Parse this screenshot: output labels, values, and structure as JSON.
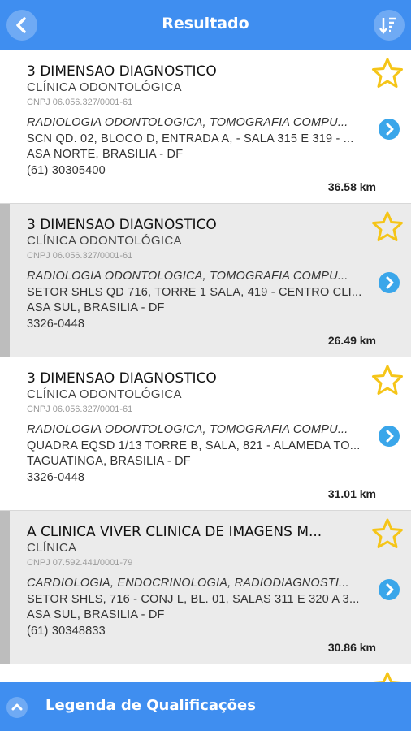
{
  "header": {
    "title": "Resultado",
    "back_icon": "chevron-left-icon",
    "sort_icon": "sort-icon"
  },
  "results": [
    {
      "name": "3 DIMENSAO DIAGNOSTICO",
      "type": "CLÍNICA ODONTOLÓGICA",
      "cnpj": "CNPJ 06.056.327/0001-61",
      "specialties": "RADIOLOGIA ODONTOLOGICA, TOMOGRAFIA COMPU...",
      "address": "SCN QD. 02, BLOCO D, ENTRADA A, - SALA 315 E 319 - ...",
      "city": "ASA NORTE, BRASILIA - DF",
      "phone": "(61) 30305400",
      "distance": "36.58 km"
    },
    {
      "name": "3 DIMENSAO DIAGNOSTICO",
      "type": "CLÍNICA ODONTOLÓGICA",
      "cnpj": "CNPJ 06.056.327/0001-61",
      "specialties": "RADIOLOGIA ODONTOLOGICA, TOMOGRAFIA COMPU...",
      "address": "SETOR SHLS QD 716, TORRE 1 SALA, 419 - CENTRO CLI...",
      "city": "ASA SUL, BRASILIA - DF",
      "phone": "3326-0448",
      "distance": "26.49 km"
    },
    {
      "name": "3 DIMENSAO DIAGNOSTICO",
      "type": "CLÍNICA ODONTOLÓGICA",
      "cnpj": "CNPJ 06.056.327/0001-61",
      "specialties": "RADIOLOGIA ODONTOLOGICA, TOMOGRAFIA COMPU...",
      "address": "QUADRA EQSD 1/13 TORRE B, SALA, 821 - ALAMEDA TO...",
      "city": "TAGUATINGA, BRASILIA - DF",
      "phone": "3326-0448",
      "distance": "31.01 km"
    },
    {
      "name": "A CLINICA VIVER CLINICA DE IMAGENS M...",
      "type": "CLÍNICA",
      "cnpj": "CNPJ 07.592.441/0001-79",
      "specialties": "CARDIOLOGIA, ENDOCRINOLOGIA, RADIODIAGNOSTI...",
      "address": "SETOR SHLS, 716 - CONJ L, BL. 01, SALAS 311 E 320 A 3...",
      "city": "ASA SUL, BRASILIA - DF",
      "phone": "(61) 30348833",
      "distance": "30.86 km"
    }
  ],
  "footer": {
    "label": "Legenda de Qualificações",
    "toggle_icon": "chevron-up-icon"
  },
  "colors": {
    "primary": "#3f8ef0",
    "star": "#f5c518",
    "chevron": "#3aa6ea"
  }
}
